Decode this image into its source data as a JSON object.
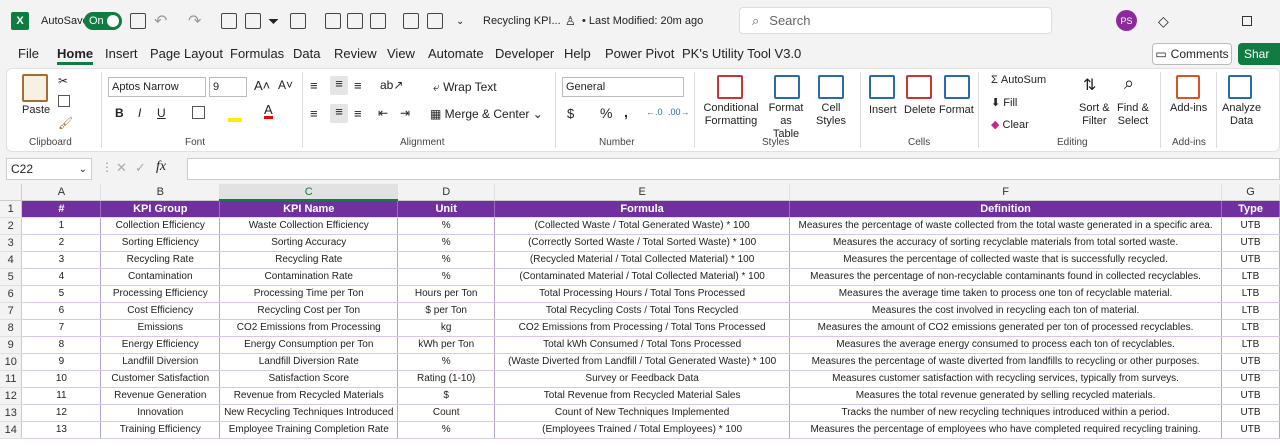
{
  "titlebar": {
    "autosave_label": "AutoSave",
    "autosave_state": "On",
    "file_name": "Recycling KPI...",
    "modified": "• Last Modified: 20m ago",
    "search_placeholder": "Search",
    "user_initials": "PS"
  },
  "menus": [
    "File",
    "Home",
    "Insert",
    "Page Layout",
    "Formulas",
    "Data",
    "Review",
    "View",
    "Automate",
    "Developer",
    "Help",
    "Power Pivot",
    "PK's Utility Tool V3.0"
  ],
  "buttons": {
    "comments": "Comments",
    "share": "Shar"
  },
  "ribbon": {
    "clipboard": {
      "paste": "Paste",
      "label": "Clipboard"
    },
    "font": {
      "name": "Aptos Narrow",
      "size": "9",
      "label": "Font"
    },
    "alignment": {
      "wrap": "Wrap Text",
      "merge": "Merge & Center",
      "label": "Alignment"
    },
    "number": {
      "format": "General",
      "label": "Number"
    },
    "styles": {
      "cond": "Conditional",
      "cond2": "Formatting",
      "fmt": "Format as",
      "fmt2": "Table",
      "cell": "Cell",
      "cell2": "Styles",
      "label": "Styles"
    },
    "cells": {
      "insert": "Insert",
      "delete": "Delete",
      "format": "Format",
      "label": "Cells"
    },
    "editing": {
      "autosum": "AutoSum",
      "fill": "Fill",
      "clear": "Clear",
      "sort": "Sort &",
      "sort2": "Filter",
      "find": "Find &",
      "find2": "Select",
      "label": "Editing"
    },
    "addins": {
      "addins": "Add-ins",
      "label": "Add-ins"
    },
    "analyze": {
      "l1": "Analyze",
      "l2": "Data"
    }
  },
  "formula_bar": {
    "name_box": "C22",
    "fx": "fx"
  },
  "columns": [
    "A",
    "B",
    "C",
    "D",
    "E",
    "F",
    "G"
  ],
  "header_row": [
    "#",
    "KPI Group",
    "KPI Name",
    "Unit",
    "Formula",
    "Definition",
    "Type"
  ],
  "rows": [
    [
      "1",
      "Collection Efficiency",
      "Waste Collection Efficiency",
      "%",
      "(Collected Waste / Total Generated Waste) * 100",
      "Measures the percentage of waste collected from the total waste generated in a specific area.",
      "UTB"
    ],
    [
      "2",
      "Sorting Efficiency",
      "Sorting Accuracy",
      "%",
      "(Correctly Sorted Waste / Total Sorted Waste) * 100",
      "Measures the accuracy of sorting recyclable materials from total sorted waste.",
      "UTB"
    ],
    [
      "3",
      "Recycling Rate",
      "Recycling Rate",
      "%",
      "(Recycled Material / Total Collected Material) * 100",
      "Measures the percentage of collected waste that is successfully recycled.",
      "UTB"
    ],
    [
      "4",
      "Contamination",
      "Contamination Rate",
      "%",
      "(Contaminated Material / Total Collected Material) * 100",
      "Measures the percentage of non-recyclable contaminants found in collected recyclables.",
      "LTB"
    ],
    [
      "5",
      "Processing Efficiency",
      "Processing Time per Ton",
      "Hours per Ton",
      "Total Processing Hours / Total Tons Processed",
      "Measures the average time taken to process one ton of recyclable material.",
      "LTB"
    ],
    [
      "6",
      "Cost Efficiency",
      "Recycling Cost per Ton",
      "$ per Ton",
      "Total Recycling Costs / Total Tons Recycled",
      "Measures the cost involved in recycling each ton of material.",
      "LTB"
    ],
    [
      "7",
      "Emissions",
      "CO2 Emissions from Processing",
      "kg",
      "CO2 Emissions from Processing / Total Tons Processed",
      "Measures the amount of CO2 emissions generated per ton of processed recyclables.",
      "LTB"
    ],
    [
      "8",
      "Energy Efficiency",
      "Energy Consumption per Ton",
      "kWh per Ton",
      "Total kWh Consumed / Total Tons Processed",
      "Measures the average energy consumed to process each ton of recyclables.",
      "LTB"
    ],
    [
      "9",
      "Landfill Diversion",
      "Landfill Diversion Rate",
      "%",
      "(Waste Diverted from Landfill / Total Generated Waste) * 100",
      "Measures the percentage of waste diverted from landfills to recycling or other purposes.",
      "UTB"
    ],
    [
      "10",
      "Customer Satisfaction",
      "Satisfaction Score",
      "Rating (1-10)",
      "Survey or Feedback Data",
      "Measures customer satisfaction with recycling services, typically from surveys.",
      "UTB"
    ],
    [
      "11",
      "Revenue Generation",
      "Revenue from Recycled Materials",
      "$",
      "Total Revenue from Recycled Material Sales",
      "Measures the total revenue generated by selling recycled materials.",
      "UTB"
    ],
    [
      "12",
      "Innovation",
      "New Recycling Techniques Introduced",
      "Count",
      "Count of New Techniques Implemented",
      "Tracks the number of new recycling techniques introduced within a period.",
      "UTB"
    ],
    [
      "13",
      "Training Efficiency",
      "Employee Training Completion Rate",
      "%",
      "(Employees Trained / Total Employees) * 100",
      "Measures the percentage of employees who have completed required recycling training.",
      "UTB"
    ]
  ]
}
